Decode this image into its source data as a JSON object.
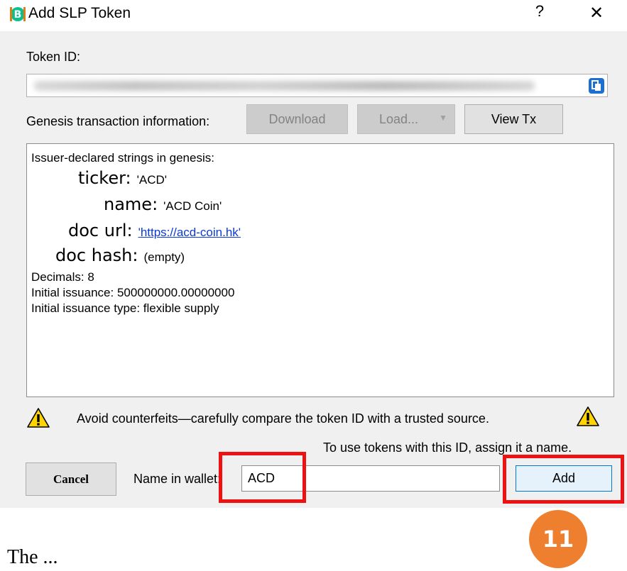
{
  "window": {
    "title": "Add SLP Token",
    "help_label": "?",
    "close_label": "✕"
  },
  "token_id": {
    "label": "Token ID:",
    "value_hidden": true
  },
  "genesis": {
    "label": "Genesis transaction information:",
    "download_label": "Download",
    "load_label": "Load...",
    "view_tx_label": "View Tx"
  },
  "info": {
    "header": "Issuer-declared strings in genesis:",
    "ticker_key": "ticker:",
    "ticker_val": "'ACD'",
    "name_key": "name:",
    "name_val": "'ACD Coin'",
    "doc_url_key": "doc url:",
    "doc_url_val": "'https://acd-coin.hk'",
    "doc_hash_key": "doc hash:",
    "doc_hash_val": "(empty)",
    "decimals": "Decimals: 8",
    "initial_issuance": "Initial issuance: 500000000.00000000",
    "issuance_type": "Initial issuance type: flexible supply"
  },
  "warning": "Avoid counterfeits—carefully compare the token ID with a trusted source.",
  "hint": "To use tokens with this ID, assign it a name.",
  "footer": {
    "cancel_label": "Cancel",
    "name_label": "Name in wallet:",
    "name_value": "ACD",
    "add_label": "Add"
  },
  "step_badge": "11",
  "below_caption": "The ...",
  "colors": {
    "highlight": "#ee1111",
    "badge": "#ee7f2f",
    "link": "#0b3bd6"
  }
}
